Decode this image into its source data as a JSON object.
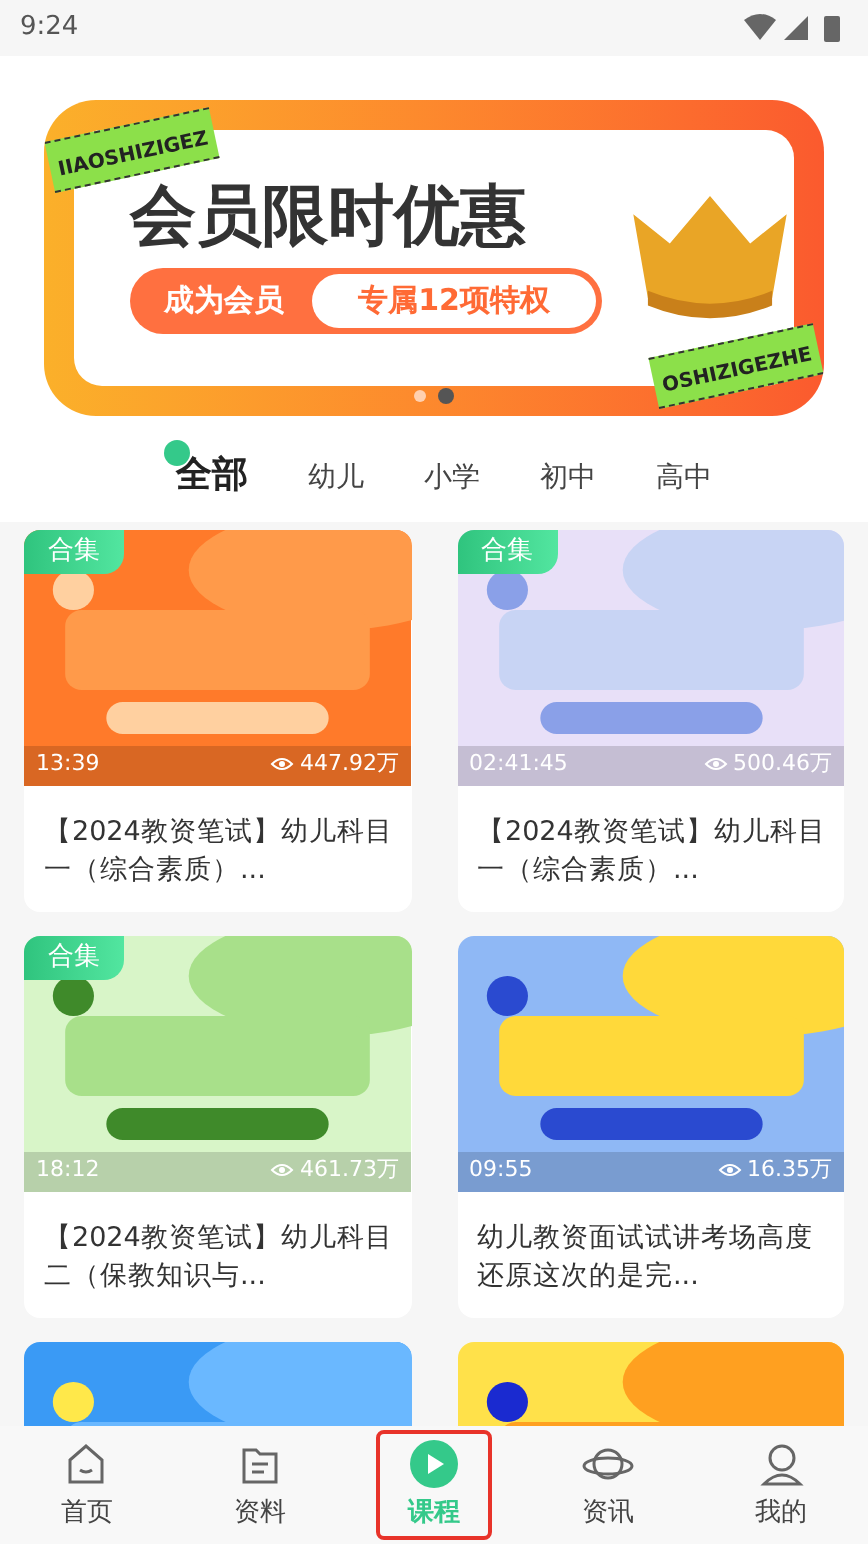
{
  "status_bar": {
    "time": "9:24"
  },
  "banner": {
    "title": "会员限时优惠",
    "cta": "成为会员",
    "perk": "专属12项特权",
    "ribbon_top": "IIAOSHIZIGEZ",
    "ribbon_bottom": "OSHIZIGEZHE",
    "dots": [
      {
        "selected": false
      },
      {
        "selected": true
      }
    ]
  },
  "tabs": [
    {
      "label": "全部",
      "selected": true
    },
    {
      "label": "幼儿",
      "selected": false
    },
    {
      "label": "小学",
      "selected": false
    },
    {
      "label": "初中",
      "selected": false
    },
    {
      "label": "高中",
      "selected": false
    }
  ],
  "courses": [
    {
      "kind": "card",
      "badge": "合集",
      "duration": "13:39",
      "views": "447.92万",
      "title": "【2024教资笔试】幼儿科目一（综合素质）..."
    },
    {
      "kind": "card",
      "badge": "合集",
      "duration": "02:41:45",
      "views": "500.46万",
      "title": "【2024教资笔试】幼儿科目一（综合素质）..."
    },
    {
      "kind": "card",
      "badge": "合集",
      "duration": "18:12",
      "views": "461.73万",
      "title": "【2024教资笔试】幼儿科目二（保教知识与..."
    },
    {
      "kind": "card",
      "duration": "09:55",
      "views": "16.35万",
      "title": "幼儿教资面试试讲考场高度还原这次的是完..."
    },
    {
      "kind": "picture"
    },
    {
      "kind": "picture"
    }
  ],
  "bottom_nav": [
    {
      "label": "首页",
      "selected": false
    },
    {
      "label": "资料",
      "selected": false
    },
    {
      "label": "课程",
      "selected": true
    },
    {
      "label": "资讯",
      "selected": false
    },
    {
      "label": "我的",
      "selected": false
    }
  ]
}
